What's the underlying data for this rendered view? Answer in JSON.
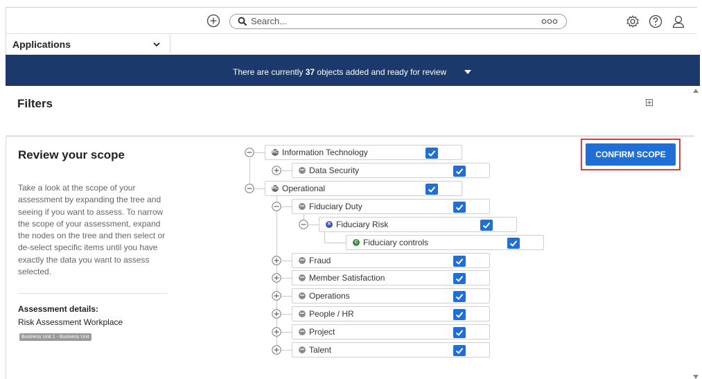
{
  "header": {
    "search_placeholder": "Search...",
    "icons": [
      "add-icon",
      "search-icon",
      "more-dots-icon",
      "gear-icon",
      "help-icon",
      "user-icon"
    ]
  },
  "apps": {
    "label": "Applications"
  },
  "banner": {
    "prefix": "There are currently ",
    "count": "37",
    "suffix": " objects added and ready for review"
  },
  "filters": {
    "title": "Filters"
  },
  "review": {
    "title": "Review your scope",
    "description": "Take a look at the scope of your assessment by expanding the tree and seeing if you want to assess. To narrow the scope of your assessment, expand the nodes on the tree and then select or de-select specific items until you have exactly the data you want to assess selected.",
    "details_label": "Assessment details:",
    "details_value": "Risk Assessment Workplace",
    "badge": "Business Unit 1 - Business Unit"
  },
  "confirm": {
    "label": "CONFIRM SCOPE"
  },
  "tree": [
    {
      "label": "Information Technology",
      "badge": "RC",
      "badge_color": "#6b6b6b",
      "expanded": true,
      "checked": true
    },
    {
      "label": "Data Security",
      "badge": "•••",
      "badge_color": "#8a8a8a",
      "expanded": false,
      "checked": true
    },
    {
      "label": "Operational",
      "badge": "RC",
      "badge_color": "#6b6b6b",
      "expanded": true,
      "checked": true
    },
    {
      "label": "Fiduciary Duty",
      "badge": "•••",
      "badge_color": "#8a8a8a",
      "expanded": true,
      "checked": true
    },
    {
      "label": "Fiduciary Risk",
      "badge": "R",
      "badge_color": "#3b52c4",
      "expanded": true,
      "checked": true
    },
    {
      "label": "Fiduciary controls",
      "badge": "C",
      "badge_color": "#3a8a3a",
      "expanded": null,
      "checked": true
    },
    {
      "label": "Fraud",
      "badge": "•••",
      "badge_color": "#8a8a8a",
      "expanded": false,
      "checked": true
    },
    {
      "label": "Member Satisfaction",
      "badge": "•••",
      "badge_color": "#8a8a8a",
      "expanded": false,
      "checked": true
    },
    {
      "label": "Operations",
      "badge": "•••",
      "badge_color": "#8a8a8a",
      "expanded": false,
      "checked": true
    },
    {
      "label": "People / HR",
      "badge": "•••",
      "badge_color": "#8a8a8a",
      "expanded": false,
      "checked": true
    },
    {
      "label": "Project",
      "badge": "•••",
      "badge_color": "#8a8a8a",
      "expanded": false,
      "checked": true
    },
    {
      "label": "Talent",
      "badge": "•••",
      "badge_color": "#8a8a8a",
      "expanded": false,
      "checked": true
    }
  ],
  "colors": {
    "banner": "#1b3a6b",
    "accent": "#1f6fd6",
    "highlight": "#e53935"
  }
}
